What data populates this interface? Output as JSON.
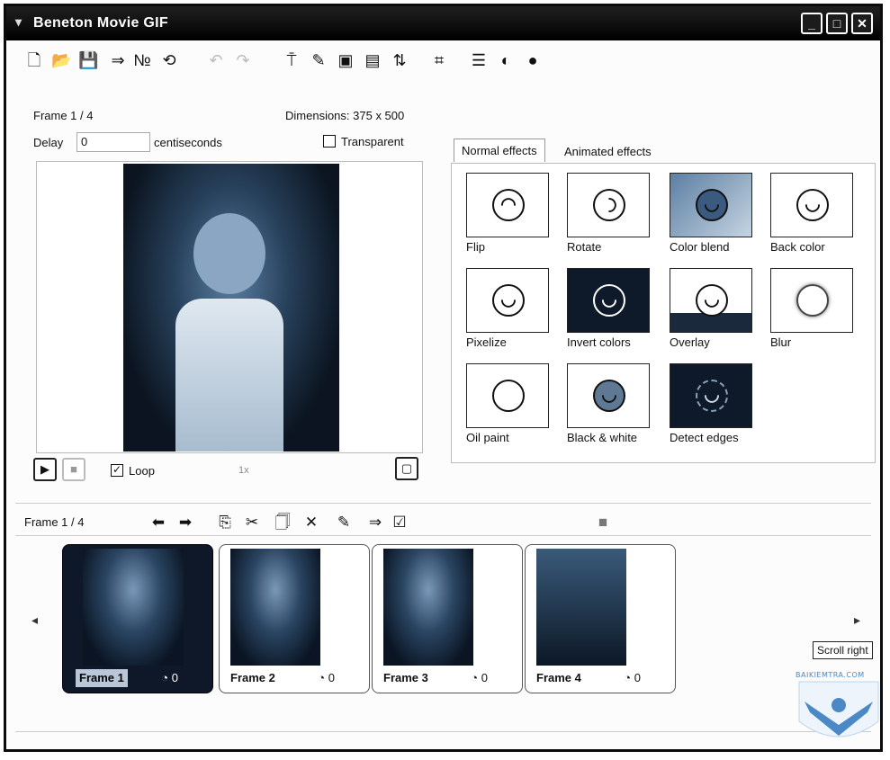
{
  "window": {
    "title": "Beneton Movie GIF"
  },
  "toolbar": {
    "icons": [
      "new-icon",
      "open-icon",
      "save-icon",
      "export-icon",
      "numbering-icon",
      "refresh-icon",
      "undo-icon",
      "redo-icon",
      "insert-frame-icon",
      "edit-frame-icon",
      "frame-icon",
      "frame-props-icon",
      "frame-numbers-icon",
      "resize-icon",
      "list-icon",
      "effects-icon",
      "web-icon"
    ]
  },
  "editor": {
    "frame_label": "Frame 1 / 4",
    "dimensions_label": "Dimensions: 375 x 500",
    "delay_label": "Delay",
    "delay_value": "0",
    "delay_unit": "centiseconds",
    "transparent_label": "Transparent",
    "loop_label": "Loop",
    "speed_label": "1x"
  },
  "effects": {
    "tabs": [
      "Normal effects",
      "Animated effects"
    ],
    "active_tab": "Normal effects",
    "items": [
      {
        "label": "Flip",
        "icon": "flip-face-icon"
      },
      {
        "label": "Rotate",
        "icon": "rotate-face-icon"
      },
      {
        "label": "Color blend",
        "icon": "color-blend-face-icon"
      },
      {
        "label": "Back color",
        "icon": "back-color-face-icon"
      },
      {
        "label": "Pixelize",
        "icon": "pixelize-face-icon"
      },
      {
        "label": "Invert colors",
        "icon": "invert-face-icon"
      },
      {
        "label": "Overlay",
        "icon": "overlay-face-icon"
      },
      {
        "label": "Blur",
        "icon": "blur-face-icon"
      },
      {
        "label": "Oil paint",
        "icon": "oil-paint-face-icon"
      },
      {
        "label": "Black & white",
        "icon": "bw-face-icon"
      },
      {
        "label": "Detect edges",
        "icon": "edges-face-icon"
      }
    ]
  },
  "strip": {
    "frame_label": "Frame 1 / 4",
    "frames": [
      {
        "label": "Frame 1",
        "delay": "0"
      },
      {
        "label": "Frame 2",
        "delay": "0"
      },
      {
        "label": "Frame 3",
        "delay": "0"
      },
      {
        "label": "Frame 4",
        "delay": "0"
      }
    ],
    "tooltip": "Scroll right"
  },
  "watermark": {
    "text": "BAIKIEMTRA.COM"
  }
}
